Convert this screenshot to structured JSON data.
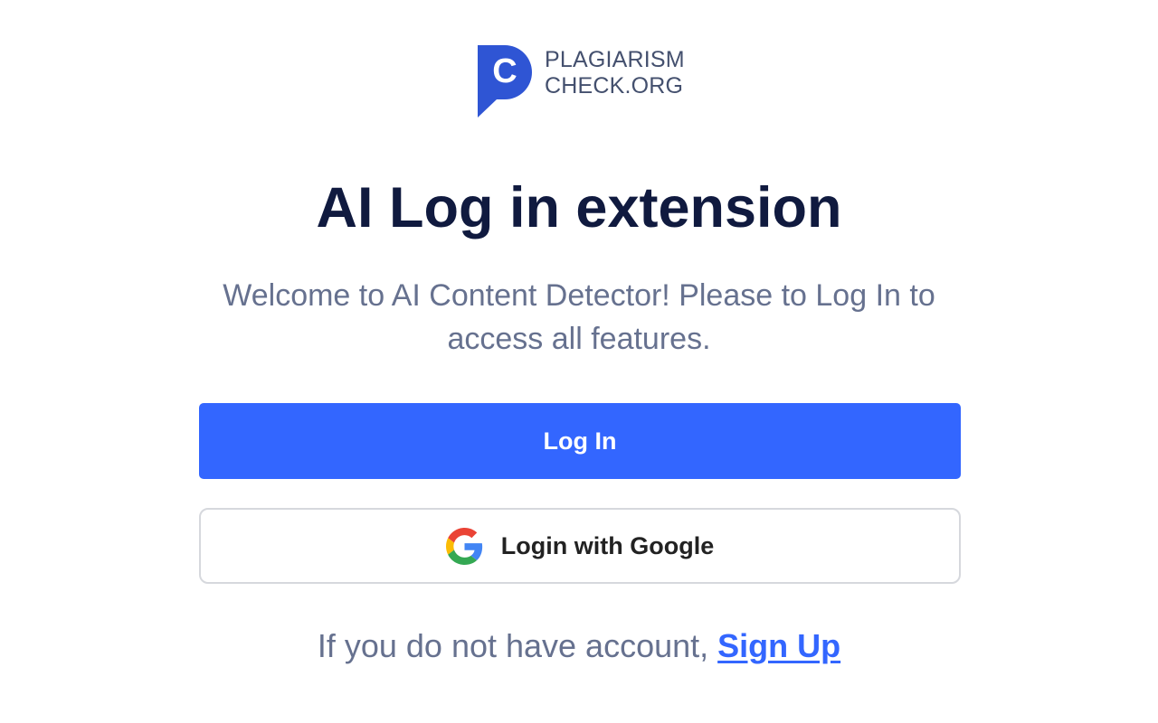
{
  "brand": {
    "line1": "PLAGIARISM",
    "line2": "CHECK.ORG",
    "mark_letter": "C",
    "mark_icon": "speech-bubble-c-logo",
    "color": "#2f55d4"
  },
  "page": {
    "title": "AI Log in extension",
    "subtitle": "Welcome to AI Content Detector! Please to Log In to access all features."
  },
  "buttons": {
    "login_label": "Log In",
    "google_label": "Login with Google",
    "google_icon": "google-g-icon"
  },
  "footer": {
    "prompt": "If you do not have account, ",
    "signup_label": "Sign Up"
  },
  "colors": {
    "accent": "#3366ff",
    "title": "#101a3f",
    "muted_text": "#66718f"
  }
}
